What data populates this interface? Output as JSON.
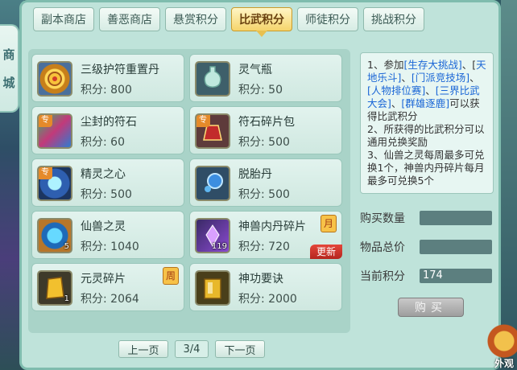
{
  "side_tab": [
    "商",
    "城"
  ],
  "tabs": [
    {
      "label": "副本商店",
      "active": false
    },
    {
      "label": "善恶商店",
      "active": false
    },
    {
      "label": "悬赏积分",
      "active": false
    },
    {
      "label": "比武积分",
      "active": true
    },
    {
      "label": "师徒积分",
      "active": false
    },
    {
      "label": "挑战积分",
      "active": false
    }
  ],
  "items": [
    {
      "name": "三级护符重置丹",
      "score": "积分: 800"
    },
    {
      "name": "灵气瓶",
      "score": "积分: 50"
    },
    {
      "name": "尘封的符石",
      "score": "积分: 60",
      "badge": "专"
    },
    {
      "name": "符石碎片包",
      "score": "积分: 500",
      "badge": "专"
    },
    {
      "name": "精灵之心",
      "score": "积分: 500",
      "badge": "专"
    },
    {
      "name": "脱胎丹",
      "score": "积分: 500"
    },
    {
      "name": "仙兽之灵",
      "score": "积分: 1040",
      "count": "5"
    },
    {
      "name": "神兽内丹碎片",
      "score": "积分: 720",
      "count": "119",
      "tag": "月",
      "new_label": "更新"
    },
    {
      "name": "元灵碎片",
      "score": "积分: 2064",
      "count": "1",
      "tag": "周"
    },
    {
      "name": "神功要诀",
      "score": "积分: 2000"
    }
  ],
  "pager": {
    "prev": "上一页",
    "page": "3/4",
    "next": "下一页"
  },
  "info": {
    "t1": "1、参加",
    "l1": "[生存大挑战]",
    "t2": "、[",
    "l2": "天地乐斗]",
    "t3": "、",
    "l3": "[门派竞技场]",
    "t4": "、",
    "l4": "[人物排位赛]",
    "t5": "、",
    "l5": "[三界比武大会]",
    "t6": "、",
    "l6": "[群雄逐鹿]",
    "t7": "可以获得比武积分",
    "p2": "2、所获得的比武积分可以通用兑换奖励",
    "p3": "3、仙兽之灵每周最多可兑换1个，神兽内丹碎片每月最多可兑换5个"
  },
  "fields": {
    "qty_label": "购买数量",
    "qty_value": "",
    "total_label": "物品总价",
    "total_value": "",
    "current_label": "当前积分",
    "current_value": "174"
  },
  "buy_label": "购买",
  "corner_label": "外观"
}
